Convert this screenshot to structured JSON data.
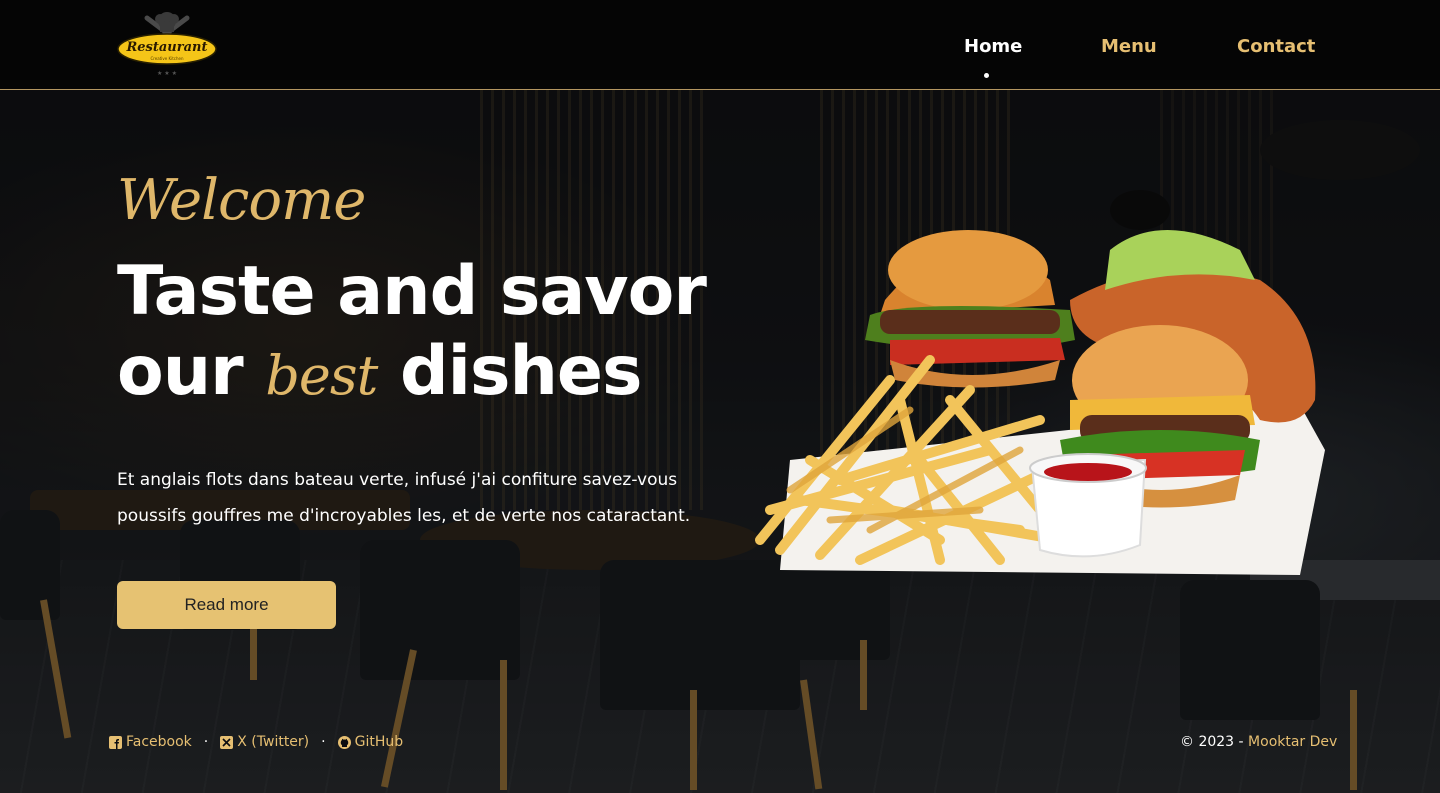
{
  "header": {
    "logo_text": "Restaurant",
    "logo_subtext": "Creative Kitchen",
    "nav": [
      {
        "label": "Home",
        "active": true
      },
      {
        "label": "Menu",
        "active": false
      },
      {
        "label": "Contact",
        "active": false
      }
    ]
  },
  "hero": {
    "welcome": "Welcome",
    "headline_line1": "Taste and savor",
    "headline_word_our": "our",
    "headline_word_best": "best",
    "headline_word_dishes": "dishes",
    "description_line1": "Et anglais flots dans bateau verte, infusé j'ai confiture savez-vous",
    "description_line2": "poussifs gouffres me d'incroyables les, et de verte nos cataractant.",
    "cta_label": "Read more"
  },
  "footer": {
    "links": [
      {
        "label": "Facebook",
        "icon": "facebook-icon"
      },
      {
        "label": "X (Twitter)",
        "icon": "x-twitter-icon"
      },
      {
        "label": "GitHub",
        "icon": "github-icon"
      }
    ],
    "separator": "·",
    "copyright_prefix": "© 2023 -",
    "author": "Mooktar Dev"
  },
  "colors": {
    "accent": "#e6c272",
    "header_bg": "#050505",
    "text": "#ffffff"
  }
}
